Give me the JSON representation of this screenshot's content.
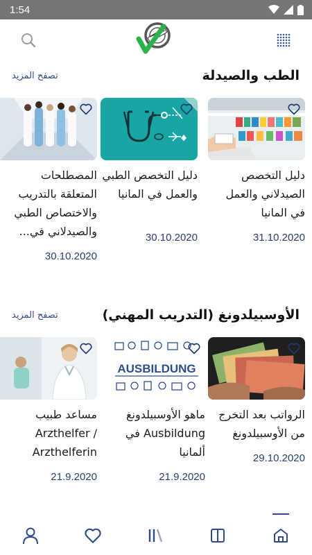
{
  "status_bar": {
    "time": "1:54"
  },
  "app_bar": {
    "menu_icon": "grid-dots-icon",
    "logo": "approved-check-logo",
    "search_icon": "search-icon"
  },
  "sections": [
    {
      "title": "الطب والصيدلة",
      "browse_more": "تصفح المزيد",
      "cards": [
        {
          "title": "دليل التخصص الصيدلاني والعمل في المانيا",
          "date": "31.10.2020"
        },
        {
          "title": "دليل التخصص الطبي والعمل في المانيا",
          "date": "30.10.2020"
        },
        {
          "title": "المصطلحات المتعلقة بالتدريب والاختصاص الطبي والصيدلاني في...",
          "date": "30.10.2020"
        }
      ]
    },
    {
      "title": "الأوسبيلدونغ (التدريب المهني)",
      "browse_more": "تصفح المزيد",
      "cards": [
        {
          "title": "الرواتب بعد التخرج من الأوسبيلدونغ",
          "date": "29.10.2020"
        },
        {
          "title": "ماهو الأوسبيلدونغ Ausbildung في ألمانيا",
          "date": "21.9.2020",
          "image_text": "AUSBILDUNG"
        },
        {
          "title": "مساعد طبيب Arzthelfer / Arzthelferin",
          "date": "21.9.2020"
        }
      ]
    }
  ],
  "bottom_nav": {
    "items": [
      "profile-icon",
      "heart-icon",
      "library-icon",
      "book-icon",
      "home-icon"
    ],
    "active": "home-icon",
    "active_color": "#2e4a8b"
  },
  "colors": {
    "accent": "#2e4a8b",
    "teal": "#1aa5a5",
    "logo_green": "#2bb24c"
  }
}
